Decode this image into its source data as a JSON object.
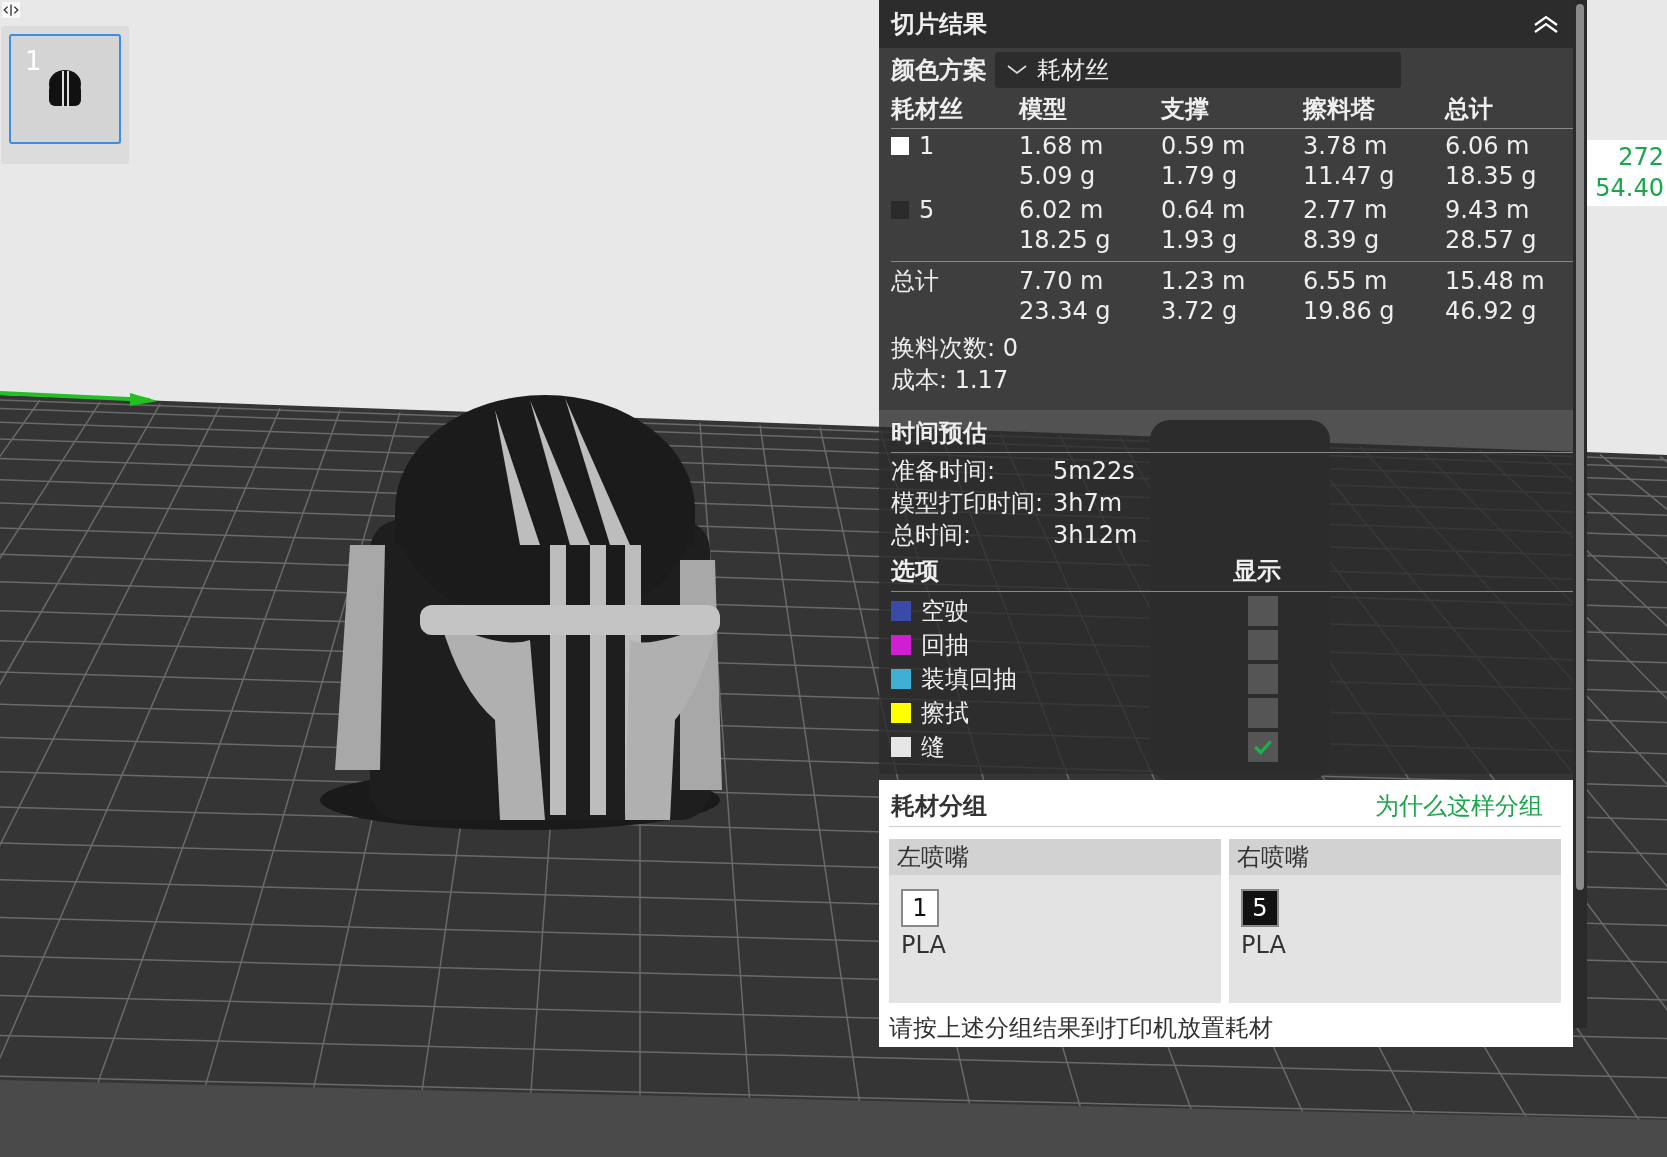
{
  "plates": [
    {
      "number": "1",
      "selected": true
    }
  ],
  "slice_results": {
    "title": "切片结果",
    "color_scheme": {
      "label": "颜色方案",
      "value": "耗材丝"
    },
    "columns": [
      "耗材丝",
      "模型",
      "支撑",
      "擦料塔",
      "总计"
    ],
    "filaments": [
      {
        "number": "1",
        "color": "#ffffff",
        "cells": [
          [
            "1.68 m",
            "5.09 g"
          ],
          [
            "0.59 m",
            "1.79 g"
          ],
          [
            "3.78 m",
            "11.47 g"
          ],
          [
            "6.06 m",
            "18.35 g"
          ]
        ]
      },
      {
        "number": "5",
        "color": "#2a2a2a",
        "cells": [
          [
            "6.02 m",
            "18.25 g"
          ],
          [
            "0.64 m",
            "1.93 g"
          ],
          [
            "2.77 m",
            "8.39 g"
          ],
          [
            "9.43 m",
            "28.57 g"
          ]
        ]
      }
    ],
    "total": {
      "label": "总计",
      "cells": [
        [
          "7.70 m",
          "23.34 g"
        ],
        [
          "1.23 m",
          "3.72 g"
        ],
        [
          "6.55 m",
          "19.86 g"
        ],
        [
          "15.48 m",
          "46.92 g"
        ]
      ]
    },
    "stats": [
      "换料次数: 0",
      "成本: 1.17"
    ]
  },
  "time_estimate": {
    "title": "时间预估",
    "rows": [
      {
        "label": "准备时间:",
        "value": "5m22s"
      },
      {
        "label": "模型打印时间:",
        "value": "3h7m"
      },
      {
        "label": "总时间:",
        "value": "3h12m"
      }
    ]
  },
  "options": {
    "columns": [
      "选项",
      "显示"
    ],
    "items": [
      {
        "label": "空驶",
        "color": "#3a4aa8",
        "checked": false
      },
      {
        "label": "回抽",
        "color": "#d21ed2",
        "checked": false
      },
      {
        "label": "装填回抽",
        "color": "#3fb0d4",
        "checked": false
      },
      {
        "label": "擦拭",
        "color": "#ffff00",
        "checked": false
      },
      {
        "label": "缝",
        "color": "#e6e6e6",
        "checked": true
      }
    ]
  },
  "filament_grouping": {
    "title": "耗材分组",
    "link": "为什么这样分组",
    "nozzles": [
      {
        "title": "左喷嘴",
        "filaments": [
          {
            "number": "1",
            "color": "#ffffff",
            "type": "PLA"
          }
        ]
      },
      {
        "title": "右喷嘴",
        "filaments": [
          {
            "number": "5",
            "color": "#111111",
            "type": "PLA"
          }
        ]
      }
    ],
    "note": "请按上述分组结果到打印机放置耗材"
  },
  "side_readout": [
    "272",
    "54.40"
  ]
}
